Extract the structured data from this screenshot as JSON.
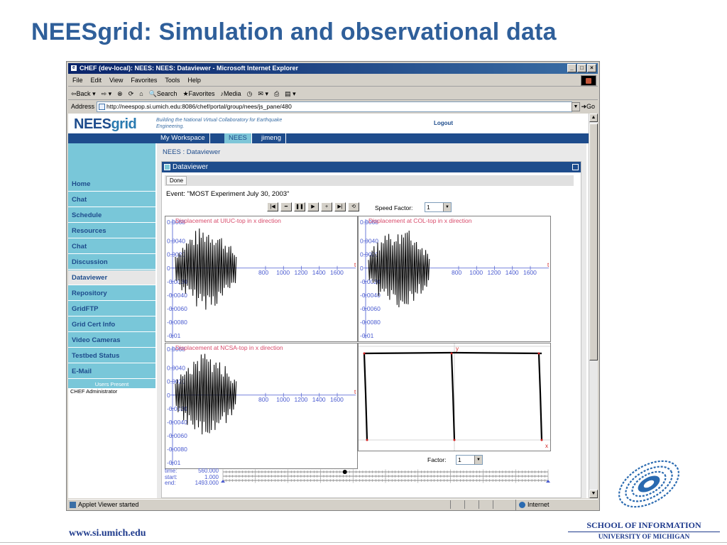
{
  "slide": {
    "title": "NEESgrid: Simulation and observational data",
    "footer_url": "www.si.umich.edu",
    "school_line1": "SCHOOL OF INFORMATION",
    "school_line2": "UNIVERSITY OF MICHIGAN"
  },
  "browser": {
    "title": "CHEF (dev-local): NEES: NEES: Dataviewer - Microsoft Internet Explorer",
    "menu": [
      "File",
      "Edit",
      "View",
      "Favorites",
      "Tools",
      "Help"
    ],
    "toolbar": [
      "Back",
      "Search",
      "Favorites",
      "Media"
    ],
    "address_label": "Address",
    "address_value": "http://neespop.si.umich.edu:8086/chef/portal/group/nees/js_pane/480",
    "go_label": "Go",
    "status_text": "Applet Viewer started",
    "zone_text": "Internet"
  },
  "portal": {
    "logo_main": "NEES",
    "logo_sub": "grid",
    "tagline": "Building the National Virtual Collaboratory for Earthquake Engineering.",
    "logout": "Logout",
    "tabs": [
      "My Workspace",
      "NEES",
      "jimeng"
    ],
    "sidebar": [
      "Home",
      "Chat",
      "Schedule",
      "Resources",
      "Chat",
      "Discussion",
      "Dataviewer",
      "Repository",
      "GridFTP",
      "Grid Cert Info",
      "Video Cameras",
      "Testbed Status",
      "E-Mail"
    ],
    "active_sidebar": "Dataviewer",
    "users_present_label": "Users Present",
    "users": [
      "CHEF Administrator"
    ],
    "breadcrumb": "NEES :  Dataviewer"
  },
  "dataviewer": {
    "panel_title": "Dataviewer",
    "done_label": "Done",
    "event": "Event: \"MOST Experiment July 30, 2003\"",
    "speed_label": "Speed Factor:",
    "speed_value": "1",
    "factor_label": "Factor:",
    "factor_value": "1",
    "time_labels": [
      "time:",
      "start:",
      "end:"
    ],
    "time_values": [
      "560.000",
      "1.000",
      "1493.000"
    ],
    "playback_position_fraction": 0.375
  },
  "chart_data": [
    {
      "type": "line",
      "title": "Displacement at UIUC-top in x direction",
      "ylim": [
        -0.01,
        0.0068
      ],
      "y_ticks": [
        "0.0068",
        "0.0040",
        "0.0020",
        "0",
        "-0.0020",
        "-0.0040",
        "-0.0060",
        "-0.0080",
        "-0.01"
      ],
      "x_ticks": [
        "800",
        "1000",
        "1200",
        "1400",
        "1600"
      ],
      "xlim": [
        0,
        1600
      ],
      "x_axis_marker": "t"
    },
    {
      "type": "line",
      "title": "Displacement at COL-top in x direction",
      "ylim": [
        -0.01,
        0.0068
      ],
      "y_ticks": [
        "0.0068",
        "0.0040",
        "0.0020",
        "0",
        "-0.0020",
        "-0.0040",
        "-0.0060",
        "-0.0080",
        "-0.01"
      ],
      "x_ticks": [
        "800",
        "1000",
        "1200",
        "1400",
        "1600"
      ],
      "xlim": [
        0,
        1600
      ],
      "x_axis_marker": "t"
    },
    {
      "type": "line",
      "title": "Displacement at NCSA-top in x direction",
      "ylim": [
        -0.01,
        0.0068
      ],
      "y_ticks": [
        "0.0068",
        "0.0040",
        "0.0020",
        "0",
        "-0.0020",
        "-0.0040",
        "-0.0060",
        "-0.0080",
        "-0.01"
      ],
      "x_ticks": [
        "800",
        "1000",
        "1200",
        "1400",
        "1600"
      ],
      "xlim": [
        0,
        1600
      ],
      "x_axis_marker": "t"
    }
  ],
  "frame_view": {
    "y_marker": "y",
    "x_marker": "x"
  },
  "colors": {
    "accent": "#1e4c8c",
    "sidebar": "#79c7d9",
    "slide_title": "#2f5f9a",
    "axis": "#4a5bd0",
    "plot_title": "#d84a6a"
  }
}
